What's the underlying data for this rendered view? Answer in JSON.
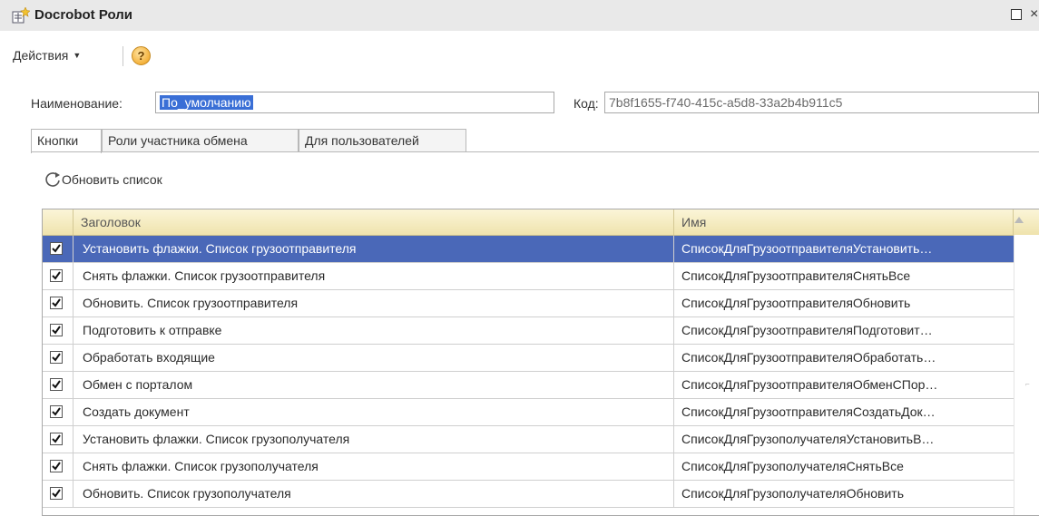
{
  "window": {
    "title": "Docrobot Роли",
    "icons": [
      "window-form-icon",
      "maximize-icon",
      "close-icon"
    ]
  },
  "menu": {
    "actions_label": "Действия",
    "help_icon_text": "?"
  },
  "form": {
    "name_label": "Наименование:",
    "name_value": "По_умолчанию",
    "code_label": "Код:",
    "code_value": "7b8f1655-f740-415c-a5d8-33a2b4b911c5"
  },
  "tabs": [
    {
      "label": "Кнопки",
      "active": true
    },
    {
      "label": "Роли участника обмена",
      "active": false
    },
    {
      "label": "Для пользователей",
      "active": false
    }
  ],
  "toolbar": {
    "refresh_label": "Обновить список"
  },
  "table": {
    "columns": [
      "Заголовок",
      "Имя"
    ],
    "rows": [
      {
        "checked": true,
        "selected": true,
        "title": "Установить флажки. Список грузоотправителя",
        "name": "СписокДляГрузоотправителяУстановить…"
      },
      {
        "checked": true,
        "selected": false,
        "title": "Снять флажки. Список грузоотправителя",
        "name": "СписокДляГрузоотправителяСнятьВсе"
      },
      {
        "checked": true,
        "selected": false,
        "title": "Обновить. Список грузоотправителя",
        "name": "СписокДляГрузоотправителяОбновить"
      },
      {
        "checked": true,
        "selected": false,
        "title": "Подготовить к отправке",
        "name": "СписокДляГрузоотправителяПодготовит…"
      },
      {
        "checked": true,
        "selected": false,
        "title": "Обработать входящие",
        "name": "СписокДляГрузоотправителяОбработать…"
      },
      {
        "checked": true,
        "selected": false,
        "title": "Обмен с порталом",
        "name": "СписокДляГрузоотправителяОбменСПор…"
      },
      {
        "checked": true,
        "selected": false,
        "title": "Создать документ",
        "name": "СписокДляГрузоотправителяСоздатьДок…"
      },
      {
        "checked": true,
        "selected": false,
        "title": "Установить флажки. Список грузополучателя",
        "name": "СписокДляГрузополучателяУстановитьВ…"
      },
      {
        "checked": true,
        "selected": false,
        "title": "Снять флажки. Список грузополучателя",
        "name": "СписокДляГрузополучателяСнятьВсе"
      },
      {
        "checked": true,
        "selected": false,
        "title": "Обновить. Список грузополучателя",
        "name": "СписокДляГрузополучателяОбновить"
      }
    ]
  },
  "colors": {
    "selection": "#4a68b8",
    "header_gradient_top": "#fbf5d8",
    "header_gradient_bottom": "#efe3ad",
    "name_highlight": "#3a6fd6"
  }
}
